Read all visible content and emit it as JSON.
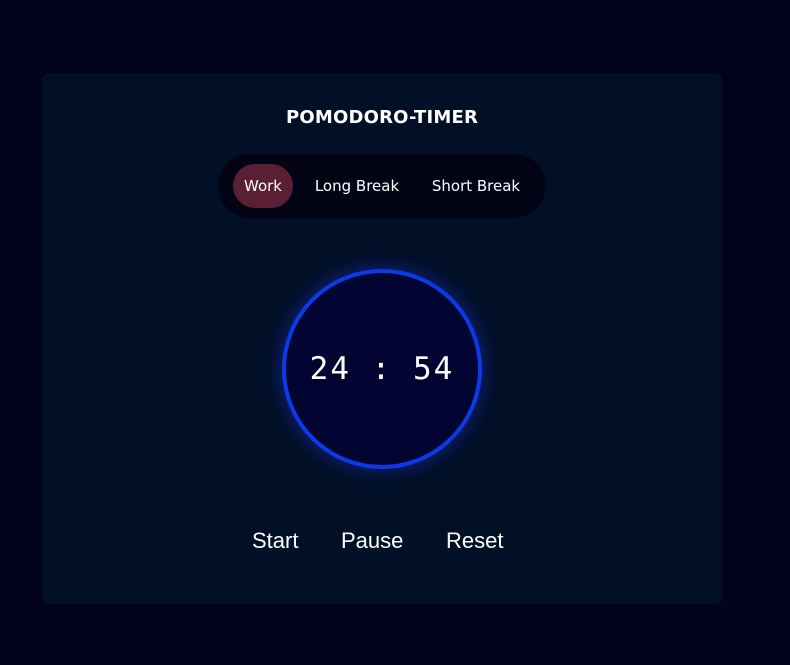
{
  "app": {
    "title": "POMODORO-TIMER"
  },
  "modes": {
    "items": [
      {
        "label": "Work",
        "active": true
      },
      {
        "label": "Long Break",
        "active": false
      },
      {
        "label": "Short Break",
        "active": false
      }
    ]
  },
  "timer": {
    "display": "24 : 54",
    "minutes": 24,
    "seconds": 54
  },
  "controls": {
    "start_label": "Start",
    "pause_label": "Pause",
    "reset_label": "Reset"
  },
  "colors": {
    "page_background": "#02031b",
    "card_background": "#021027",
    "mode_bar_background": "#020415",
    "active_mode": "#5a1f33",
    "ring": "#0b3be8",
    "text": "#ffffff"
  }
}
